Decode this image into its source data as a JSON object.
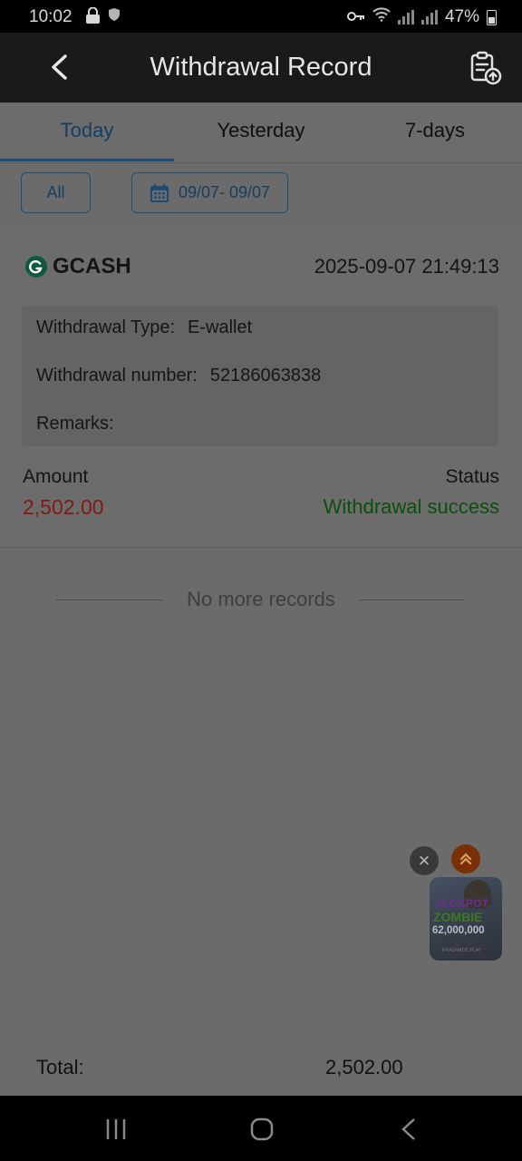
{
  "status_bar": {
    "time": "10:02",
    "battery": "47%",
    "icons": [
      "lock-icon",
      "shield-icon",
      "key-icon",
      "wifi-icon",
      "signal-icon",
      "signal-icon",
      "battery-icon"
    ]
  },
  "header": {
    "title": "Withdrawal Record",
    "back_icon": "chevron-left-icon",
    "action_icon": "clipboard-upload-icon"
  },
  "tabs": [
    {
      "label": "Today",
      "active": true
    },
    {
      "label": "Yesterday",
      "active": false
    },
    {
      "label": "7-days",
      "active": false
    }
  ],
  "filters": {
    "all_label": "All",
    "date_range": "09/07- 09/07",
    "date_icon": "calendar-icon"
  },
  "record": {
    "method": "GCASH",
    "datetime": "2025-09-07 21:49:13",
    "type_label": "Withdrawal Type:",
    "type_value": "E-wallet",
    "number_label": "Withdrawal number:",
    "number_value": "52186063838",
    "remarks_label": "Remarks:",
    "remarks_value": "",
    "amount_label": "Amount",
    "amount_value": "2,502.00",
    "status_label": "Status",
    "status_value": "Withdrawal success"
  },
  "list_end_text": "No more records",
  "ad": {
    "line1": "JACKPOT",
    "line2": "ZOMBIE",
    "line3": "62,000,000",
    "line4": "PRAGMATIC PLAY"
  },
  "footer": {
    "total_label": "Total:",
    "total_value": "2,502.00"
  },
  "colors": {
    "accent": "#1d4d72",
    "amount": "#7e1c12",
    "success": "#0c4f0c",
    "overlay_background": "#6b6b6b"
  }
}
